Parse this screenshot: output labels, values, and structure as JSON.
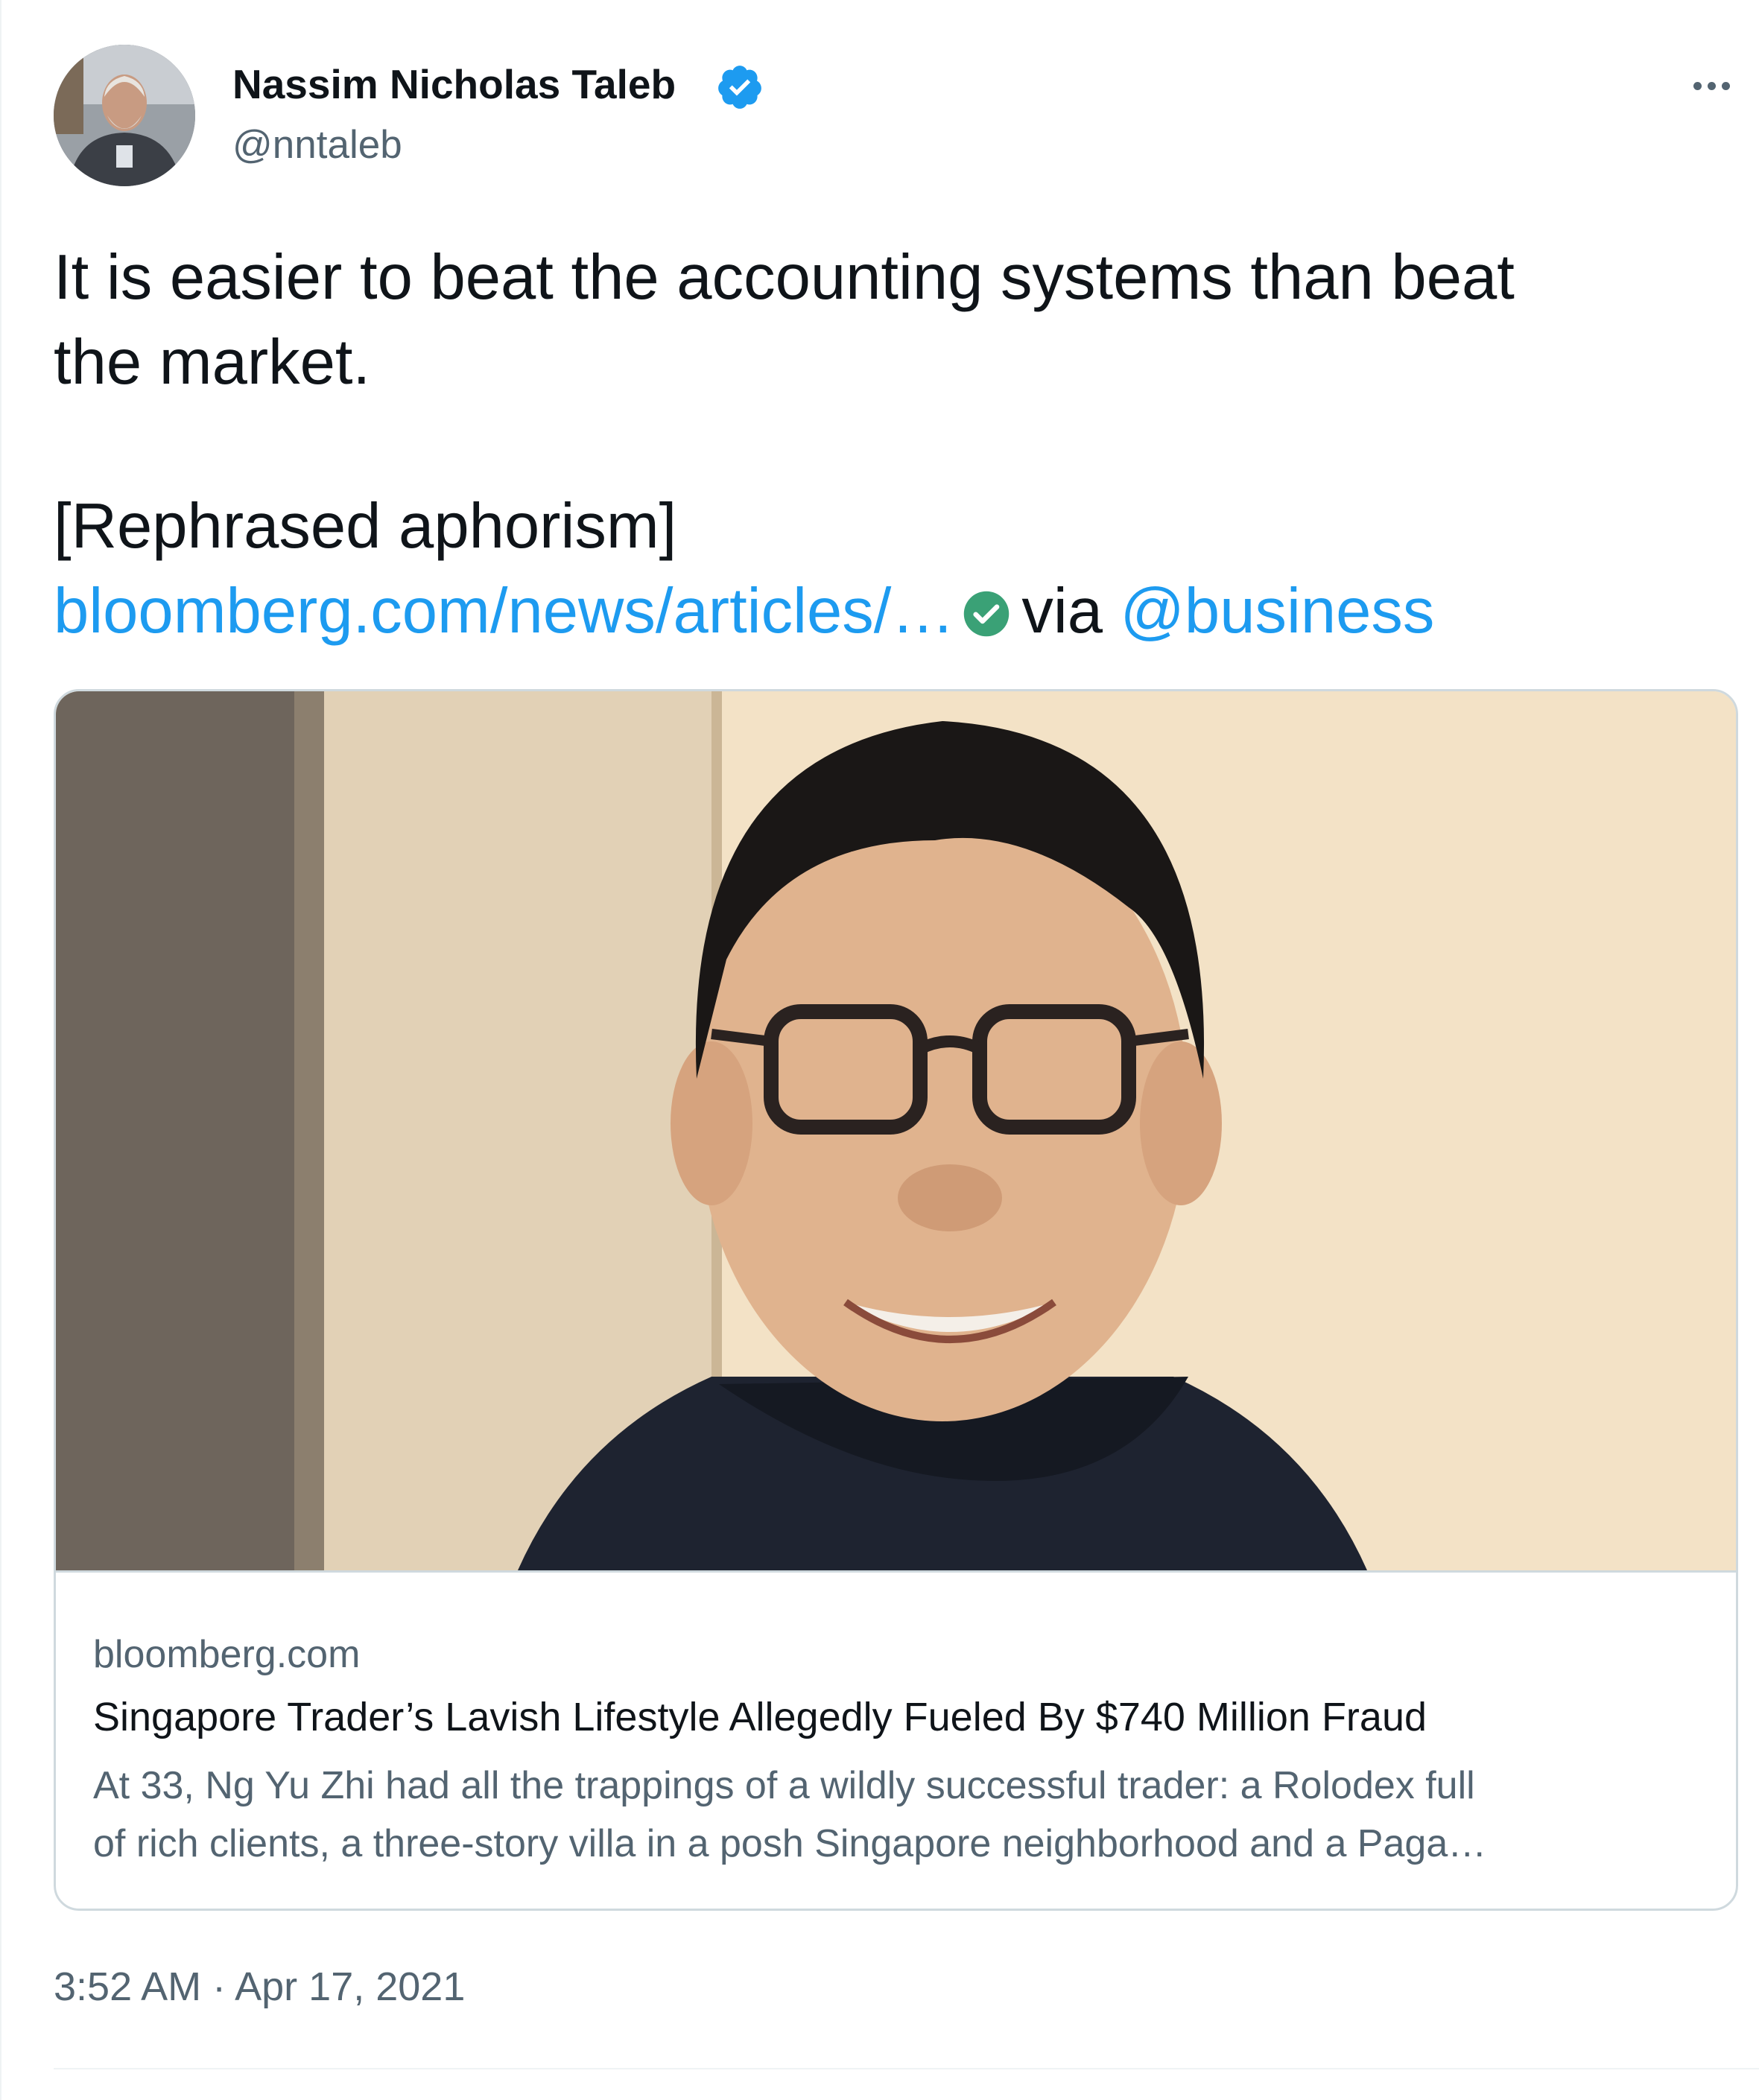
{
  "author": {
    "display_name": "Nassim Nicholas Taleb",
    "handle": "@nntaleb",
    "verified": true
  },
  "tweet": {
    "text_line_1": "It is easier to beat the accounting systems than beat",
    "text_line_2": "the market.",
    "text_line_3": "[Rephrased aphorism]",
    "link_text": "bloomberg.com/news/articles/…",
    "via_text": "via",
    "mention": "@business",
    "timestamp": "3:52 AM · Apr 17, 2021"
  },
  "card": {
    "domain": "bloomberg.com",
    "title": "Singapore Trader’s Lavish Lifestyle Allegedly Fueled By $740 Million Fraud",
    "description_line_1": "At 33, Ng Yu Zhi had all the trappings of a wildly successful trader: a Rolodex full",
    "description_line_2": "of rich clients, a three-story villa in a posh Singapore neighborhood and a Paga…"
  },
  "colors": {
    "link": "#1d9bf0",
    "verified_badge": "#1d9bf0",
    "green_check": "#3aa176",
    "secondary_text": "#536471",
    "border": "#cfd9de"
  },
  "icons": {
    "verified": "verified-badge-icon",
    "more": "more-options-icon",
    "link_check": "green-check-icon"
  }
}
